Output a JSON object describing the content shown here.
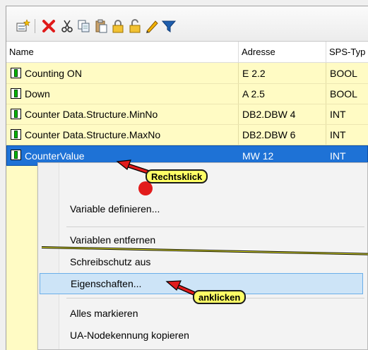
{
  "toolbar": {
    "icons": [
      "new-variable-icon",
      "delete-icon",
      "cut-icon",
      "copy-icon",
      "paste-icon",
      "lock-icon",
      "unlock-icon",
      "edit-icon",
      "filter-icon"
    ]
  },
  "table": {
    "columns": [
      "Name",
      "Adresse",
      "SPS-Typ"
    ],
    "rows": [
      {
        "name": "Counting ON",
        "address": "E 2.2",
        "type": "BOOL"
      },
      {
        "name": "Down",
        "address": "A 2.5",
        "type": "BOOL"
      },
      {
        "name": "Counter Data.Structure.MinNo",
        "address": "DB2.DBW 4",
        "type": "INT"
      },
      {
        "name": "Counter Data.Structure.MaxNo",
        "address": "DB2.DBW 6",
        "type": "INT"
      },
      {
        "name": "CounterValue",
        "address": "MW 12",
        "type": "INT"
      }
    ]
  },
  "context_menu": {
    "items": [
      "Variable definieren...",
      "Variablen entfernen",
      "Schreibschutz aus",
      "Eigenschaften...",
      "Alles markieren",
      "UA-Nodekennung kopieren"
    ]
  },
  "annotations": {
    "right_click": "Rechtsklick",
    "click": "anklicken"
  },
  "colors": {
    "row_background": "#fffbc4",
    "selection": "#1e72d6",
    "menu_hover": "#cde4f7",
    "callout": "#ffff66",
    "arrow": "#e21b1b"
  }
}
